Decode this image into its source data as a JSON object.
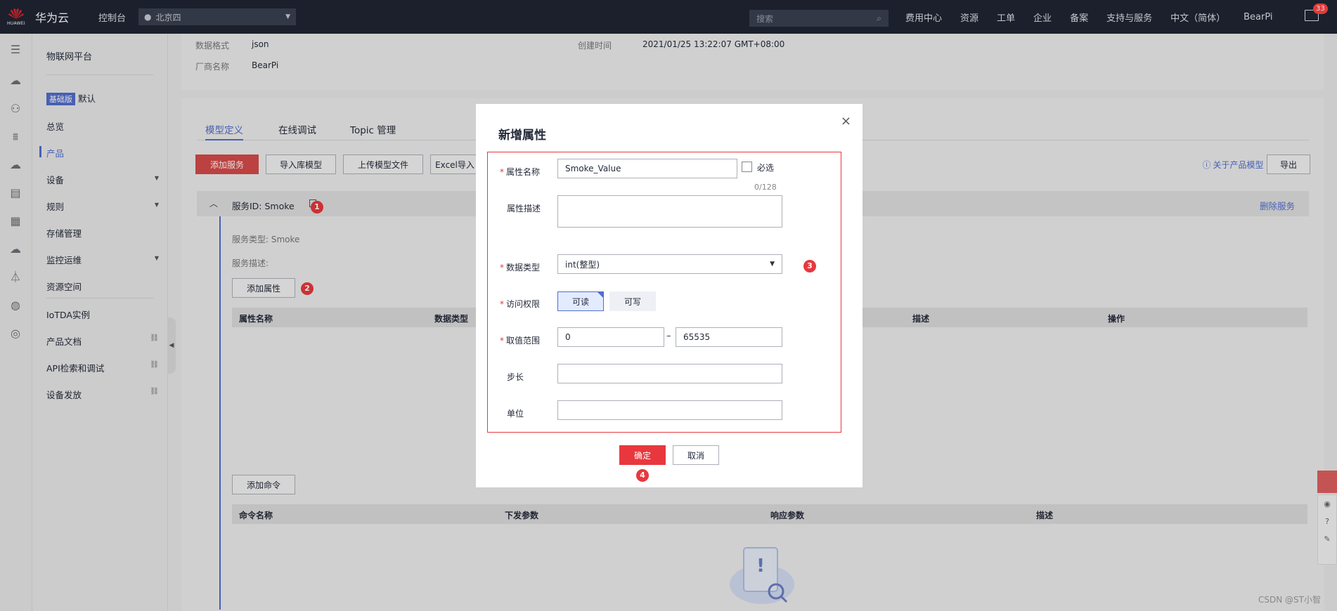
{
  "topbar": {
    "logo_word": "HUAWEI",
    "brand": "华为云",
    "console": "控制台",
    "region": "北京四",
    "search_placeholder": "搜索",
    "links": [
      "费用中心",
      "资源",
      "工单",
      "企业",
      "备案",
      "支持与服务",
      "中文（简体）",
      "BearPi"
    ],
    "mail_count": "33"
  },
  "sidebar": {
    "title": "物联网平台",
    "edition_tag": "基础版",
    "edition_name": "默认",
    "items": [
      "总览",
      "产品",
      "设备",
      "规则",
      "存储管理",
      "监控运维",
      "资源空间",
      "IoTDA实例",
      "产品文档",
      "API检索和调试",
      "设备发放"
    ],
    "active_index": 1
  },
  "info": {
    "format_label": "数据格式",
    "format_value": "json",
    "vendor_label": "厂商名称",
    "vendor_value": "BearPi",
    "created_label": "创建时间",
    "created_value": "2021/01/25 13:22:07 GMT+08:00"
  },
  "tabs": [
    "模型定义",
    "在线调试",
    "Topic 管理"
  ],
  "toolbar": {
    "add_service": "添加服务",
    "import_model": "导入库模型",
    "upload_model": "上传模型文件",
    "excel_import": "Excel导入",
    "about_model": "关于产品模型",
    "export": "导出"
  },
  "service": {
    "id_label": "服务ID: Smoke",
    "delete": "删除服务",
    "type_label": "服务类型: Smoke",
    "desc_label": "服务描述:",
    "add_property": "添加属性",
    "add_command": "添加命令"
  },
  "property_table": {
    "columns": [
      "属性名称",
      "数据类型",
      "描述",
      "操作"
    ]
  },
  "command_table": {
    "columns": [
      "命令名称",
      "下发参数",
      "响应参数",
      "描述"
    ]
  },
  "badges": [
    "1",
    "2",
    "3",
    "4"
  ],
  "modal": {
    "title": "新增属性",
    "close": "×",
    "name_label": "属性名称",
    "name_value": "Smoke_Value",
    "required_label": "必选",
    "desc_label": "属性描述",
    "desc_count": "0/128",
    "type_label": "数据类型",
    "type_value": "int(整型)",
    "access_label": "访问权限",
    "access_read": "可读",
    "access_write": "可写",
    "range_label": "取值范围",
    "range_min": "0",
    "range_max": "65535",
    "step_label": "步长",
    "unit_label": "单位",
    "ok": "确定",
    "cancel": "取消"
  },
  "watermark": "CSDN @ST小智"
}
